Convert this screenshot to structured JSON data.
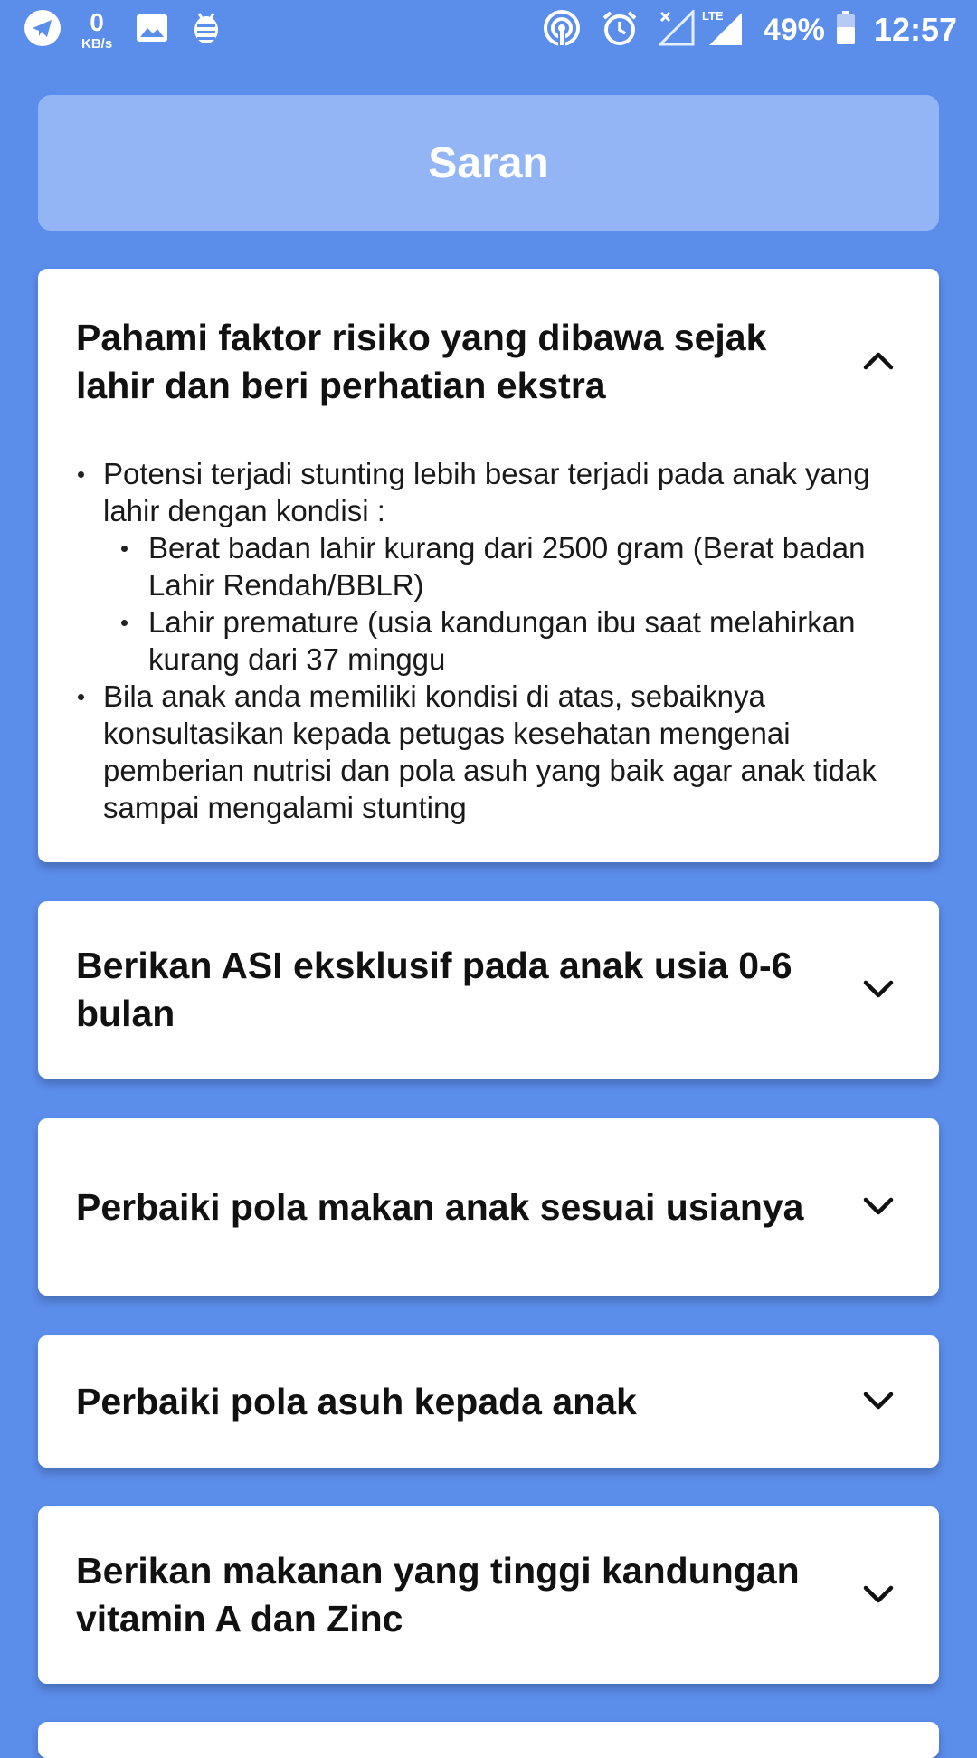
{
  "status_bar": {
    "net_speed_value": "0",
    "net_speed_unit": "KB/s",
    "network_type": "LTE",
    "battery_percent": "49%",
    "time": "12:57",
    "left_icons": [
      "telegram-icon",
      "image-icon",
      "debug-icon"
    ],
    "right_icons": [
      "hotspot-icon",
      "alarm-icon",
      "no-signal-icon",
      "lte-signal-icon",
      "battery-icon"
    ]
  },
  "header": {
    "title": "Saran"
  },
  "cards": [
    {
      "title": "Pahami faktor risiko yang dibawa sejak lahir dan beri perhatian ekstra",
      "expanded": true,
      "chevron": "chevron-up-icon",
      "body": {
        "item1": "Potensi terjadi stunting lebih besar terjadi pada anak yang lahir dengan kondisi :",
        "item1_sub1": "Berat badan lahir kurang dari 2500 gram (Berat badan Lahir Rendah/BBLR)",
        "item1_sub2": "Lahir premature (usia kandungan ibu saat melahirkan kurang dari 37 minggu",
        "item2": "Bila anak anda memiliki kondisi di atas, sebaiknya konsultasikan kepada petugas kesehatan mengenai pemberian nutrisi dan pola asuh yang baik agar anak tidak sampai mengalami stunting"
      }
    },
    {
      "title": "Berikan ASI eksklusif pada anak usia 0-6 bulan",
      "expanded": false,
      "chevron": "chevron-down-icon"
    },
    {
      "title": "Perbaiki pola makan anak sesuai usianya",
      "expanded": false,
      "chevron": "chevron-down-icon"
    },
    {
      "title": "Perbaiki pola asuh kepada anak",
      "expanded": false,
      "chevron": "chevron-down-icon"
    },
    {
      "title": "Berikan makanan yang tinggi kandungan vitamin A dan Zinc",
      "expanded": false,
      "chevron": "chevron-down-icon"
    }
  ],
  "colors": {
    "background": "#5B8DEB",
    "header_bg": "#93B5F5",
    "card_bg": "#FFFFFF",
    "text": "#111111"
  }
}
